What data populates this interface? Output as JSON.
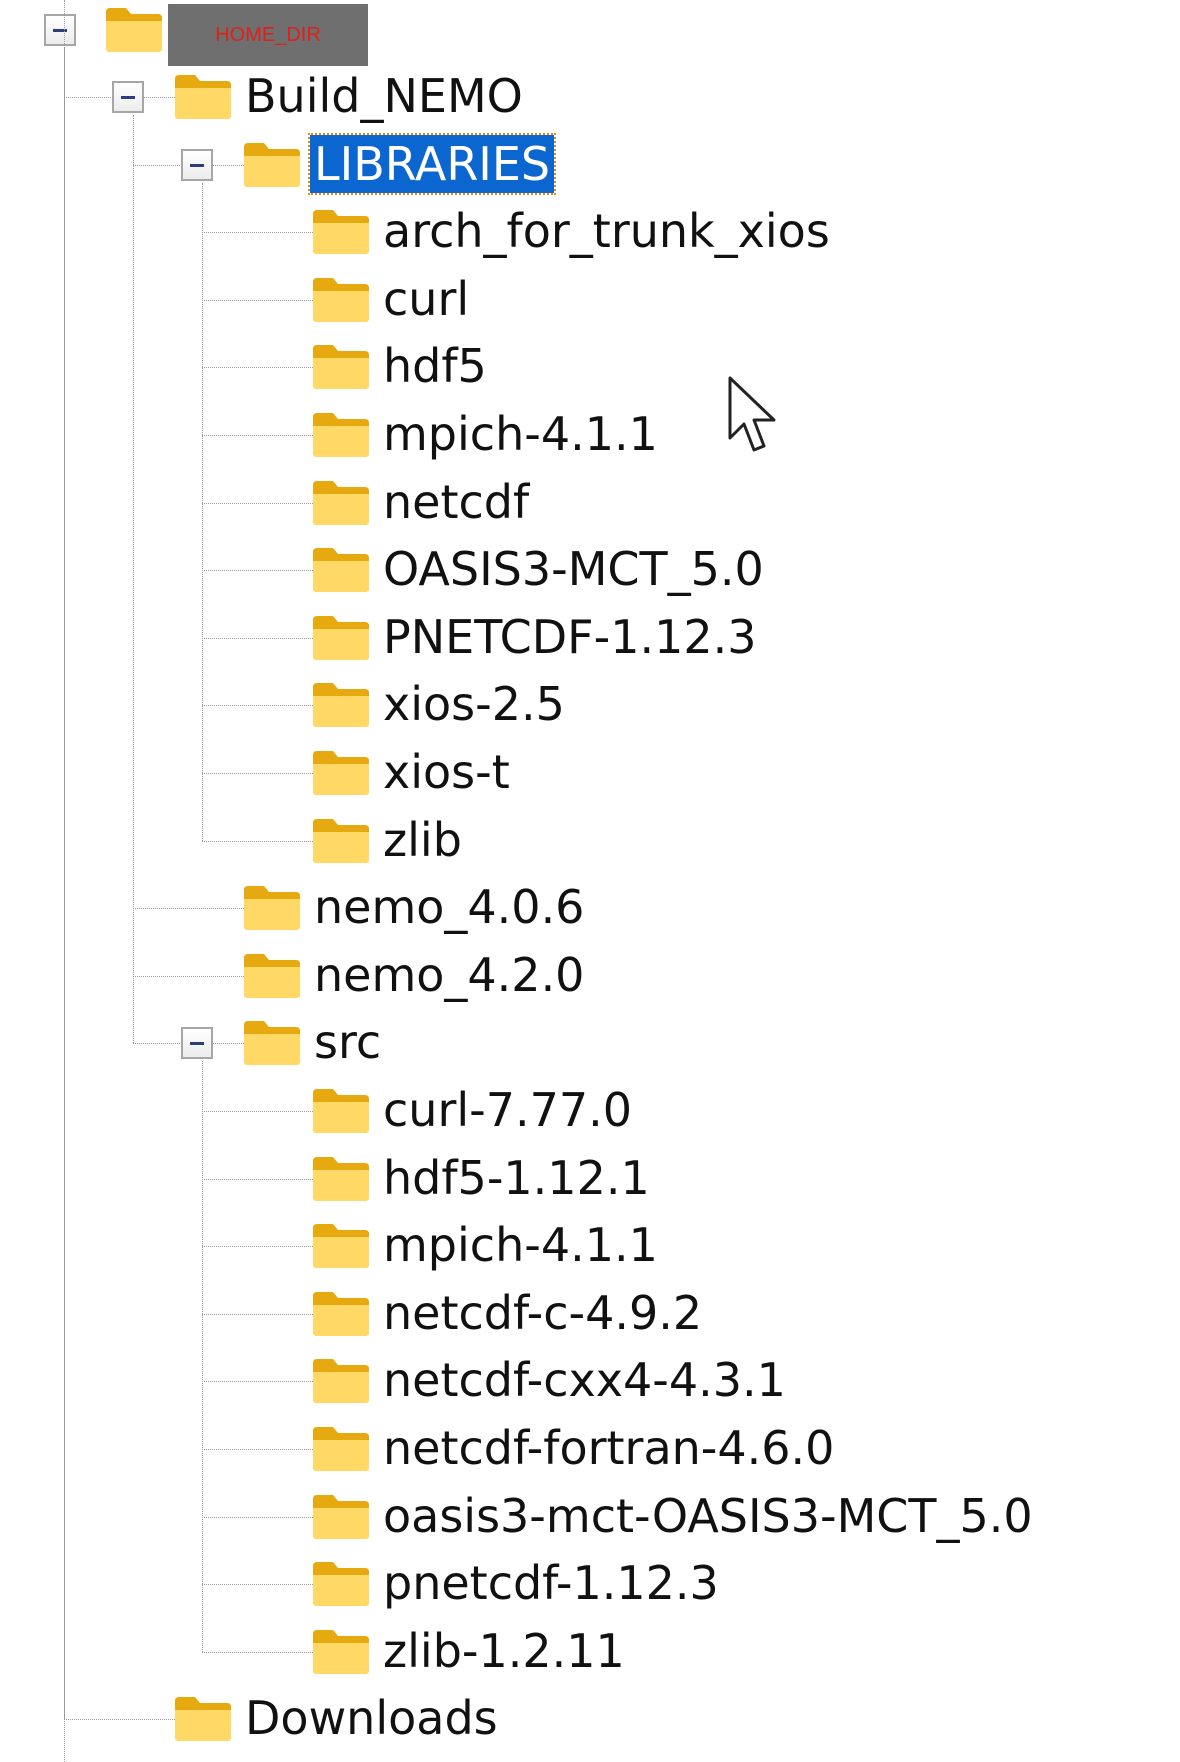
{
  "tree": {
    "root": {
      "label": "HOME_DIR"
    },
    "nodes": [
      {
        "id": "build-nemo",
        "label": "Build_NEMO",
        "depth": 1,
        "expanded": true
      },
      {
        "id": "libraries",
        "label": "LIBRARIES",
        "depth": 2,
        "expanded": true,
        "selected": true
      },
      {
        "id": "lib-arch",
        "label": "arch_for_trunk_xios",
        "depth": 3
      },
      {
        "id": "lib-curl",
        "label": "curl",
        "depth": 3
      },
      {
        "id": "lib-hdf5",
        "label": "hdf5",
        "depth": 3
      },
      {
        "id": "lib-mpich",
        "label": "mpich-4.1.1",
        "depth": 3
      },
      {
        "id": "lib-netcdf",
        "label": "netcdf",
        "depth": 3
      },
      {
        "id": "lib-oasis",
        "label": "OASIS3-MCT_5.0",
        "depth": 3
      },
      {
        "id": "lib-pnetcdf",
        "label": "PNETCDF-1.12.3",
        "depth": 3
      },
      {
        "id": "lib-xios25",
        "label": "xios-2.5",
        "depth": 3
      },
      {
        "id": "lib-xiost",
        "label": "xios-t",
        "depth": 3
      },
      {
        "id": "lib-zlib",
        "label": "zlib",
        "depth": 3
      },
      {
        "id": "nemo406",
        "label": "nemo_4.0.6",
        "depth": 2
      },
      {
        "id": "nemo420",
        "label": "nemo_4.2.0",
        "depth": 2
      },
      {
        "id": "src",
        "label": "src",
        "depth": 2,
        "expanded": true
      },
      {
        "id": "src-curl",
        "label": "curl-7.77.0",
        "depth": 3
      },
      {
        "id": "src-hdf5",
        "label": "hdf5-1.12.1",
        "depth": 3
      },
      {
        "id": "src-mpich",
        "label": "mpich-4.1.1",
        "depth": 3
      },
      {
        "id": "src-netcdf-c",
        "label": "netcdf-c-4.9.2",
        "depth": 3
      },
      {
        "id": "src-netcdf-cxx4",
        "label": "netcdf-cxx4-4.3.1",
        "depth": 3
      },
      {
        "id": "src-netcdf-fortran",
        "label": "netcdf-fortran-4.6.0",
        "depth": 3
      },
      {
        "id": "src-oasis",
        "label": "oasis3-mct-OASIS3-MCT_5.0",
        "depth": 3
      },
      {
        "id": "src-pnetcdf",
        "label": "pnetcdf-1.12.3",
        "depth": 3
      },
      {
        "id": "src-zlib",
        "label": "zlib-1.2.11",
        "depth": 3
      },
      {
        "id": "downloads",
        "label": "Downloads",
        "depth": 1
      }
    ]
  },
  "icons": {
    "expander": "collapse-minus-icon",
    "node": "folder-icon",
    "cursor": "mouse-pointer-icon"
  },
  "colors": {
    "selection": "#0b66cf",
    "folder_front": "#ffd866",
    "folder_back": "#e6a90f",
    "root_redacted_bg": "#6f6f6f",
    "root_redacted_text": "#e0201a"
  }
}
